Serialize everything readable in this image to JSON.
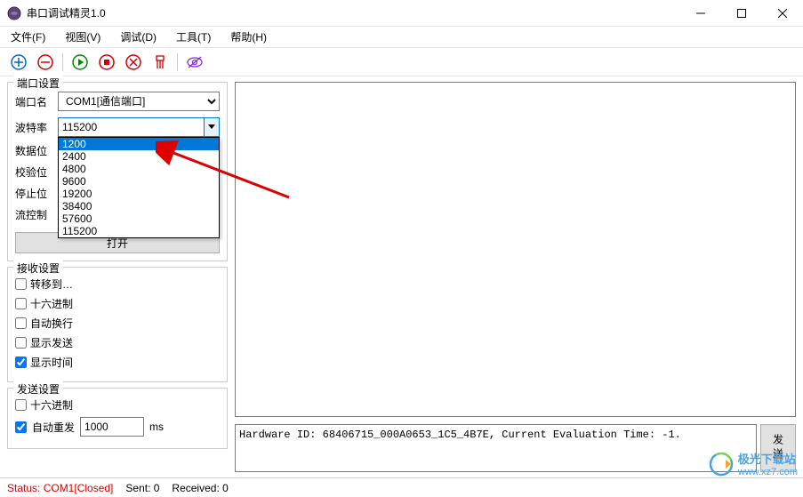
{
  "window": {
    "title": "串口调试精灵1.0"
  },
  "menu": {
    "file": "文件(F)",
    "view": "视图(V)",
    "debug": "调试(D)",
    "tools": "工具(T)",
    "help": "帮助(H)"
  },
  "port_group": {
    "title": "端口设置",
    "port_label": "端口名",
    "port_value": "COM1[通信端口]",
    "baud_label": "波特率",
    "baud_value": "115200",
    "baud_options": [
      "1200",
      "2400",
      "4800",
      "9600",
      "19200",
      "38400",
      "57600",
      "115200"
    ],
    "data_label": "数据位",
    "check_label": "校验位",
    "stop_label": "停止位",
    "flow_label": "流控制",
    "open_btn": "打开"
  },
  "recv_group": {
    "title": "接收设置",
    "redirect": "转移到…",
    "hex": "十六进制",
    "wrap": "自动换行",
    "show_send": "显示发送",
    "show_time": "显示时间"
  },
  "send_group": {
    "title": "发送设置",
    "hex": "十六进制",
    "auto_resend": "自动重发",
    "interval": "1000",
    "unit": "ms"
  },
  "output": {
    "send_text": "Hardware ID: 68406715_000A0653_1C5_4B7E, Current Evaluation Time: -1.",
    "send_btn": "发送"
  },
  "status": {
    "port": "Status: COM1[Closed]",
    "sent": "Sent: 0",
    "recv": "Received: 0"
  },
  "watermark": {
    "line1": "极光下载站",
    "line2": "www.xz7.com"
  }
}
